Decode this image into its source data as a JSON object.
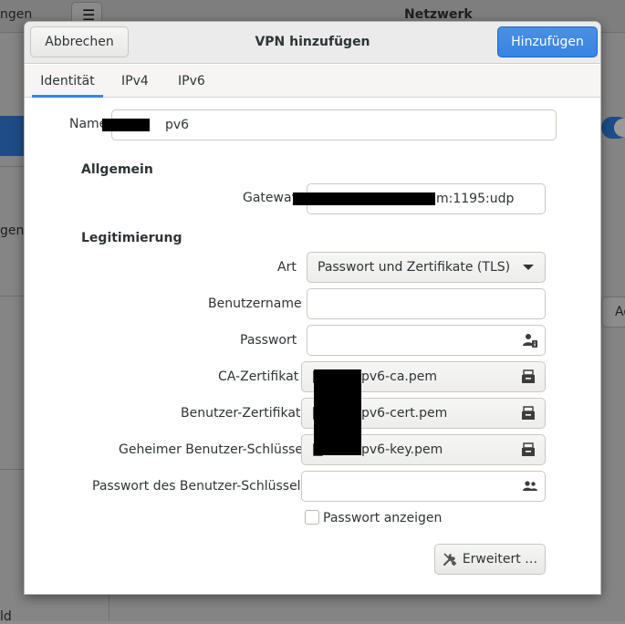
{
  "background": {
    "header_left_text": "ngen",
    "header_title": "Netzwerk",
    "sidebar_text_1": "gen",
    "sidebar_text_2": "ld",
    "right_box_text": "Ad"
  },
  "dialog": {
    "cancel_label": "Abbrechen",
    "title": "VPN hinzufügen",
    "add_label": "Hinzufügen",
    "tabs": [
      "Identität",
      "IPv4",
      "IPv6"
    ],
    "name_label": "Name",
    "name_value": "pv6",
    "general_heading": "Allgemein",
    "gateway_label": "Gateway",
    "gateway_value": "m:1195:udp",
    "auth_heading": "Legitimierung",
    "type_label": "Art",
    "type_value": "Passwort und Zertifikate (TLS)",
    "username_label": "Benutzername",
    "username_value": "",
    "password_label": "Passwort",
    "password_value": "",
    "ca_label": "CA-Zertifikat",
    "ca_value": "pv6-ca.pem",
    "user_cert_label": "Benutzer-Zertifikat",
    "user_cert_value": "pv6-cert.pem",
    "user_key_label": "Geheimer Benutzer-Schlüssel",
    "user_key_value": "pv6-key.pem",
    "key_password_label": "Passwort des Benutzer-Schlüssels",
    "key_password_value": "",
    "show_password_label": "Passwort anzeigen",
    "advanced_label": "Erweitert …"
  },
  "colors": {
    "accent": "#3584e4",
    "background_dim": "#848484"
  }
}
